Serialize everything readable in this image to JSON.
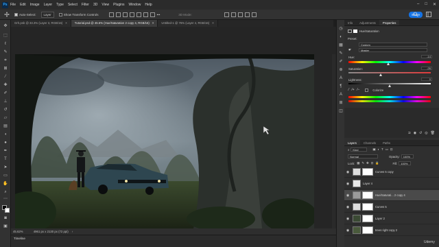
{
  "menubar": {
    "logo": "Ps",
    "items": [
      "File",
      "Edit",
      "Image",
      "Layer",
      "Type",
      "Select",
      "Filter",
      "3D",
      "View",
      "Plugins",
      "Window",
      "Help"
    ],
    "window_controls": [
      "–",
      "□",
      "✕"
    ]
  },
  "options": {
    "auto_select_label": "Auto-Select:",
    "auto_select_value": "Layer",
    "show_transform": "Show Transform Controls",
    "mode_3d": "3D Mode:",
    "share_label": "Share"
  },
  "tabs": [
    {
      "label": "Grh.psb @ 33.3% (Layer 3, RGB/16)",
      "active": false
    },
    {
      "label": "Tutorial.psd @ 45.6% (Hue/Saturation 2 copy 4, RGB/16)",
      "active": true
    },
    {
      "label": "Untitled-1 @ 76% (Layer 4, RGB/16)",
      "active": false
    }
  ],
  "tab_close": "×",
  "status": {
    "zoom": "45.62%",
    "doc_info": "4961 px x 2130 px (72 ppi)",
    "chevron": "›"
  },
  "timeline": {
    "label": "Timeline"
  },
  "properties": {
    "tabs": [
      "Info",
      "Adjustments",
      "Properties"
    ],
    "active_tab": "Properties",
    "title": "Hue/Saturation",
    "preset_label": "Preset:",
    "preset_value": "Custom",
    "channel_value": "Master",
    "hue_label": "Hue:",
    "hue_value": "-14",
    "hue_level": 0.48,
    "saturation_label": "Saturation:",
    "saturation_value": "-26",
    "saturation_level": 0.39,
    "lightness_label": "Lightness:",
    "lightness_value": "0",
    "lightness_level": 0.5,
    "colorize_label": "Colorize"
  },
  "layers_panel": {
    "tabs": [
      "Layers",
      "Channels",
      "Paths"
    ],
    "active_tab": "Layers",
    "kind_label": "Kind",
    "blend_mode": "Normal",
    "opacity_label": "Opacity:",
    "opacity_value": "100%",
    "lock_label": "Lock:",
    "fill_label": "Fill:",
    "fill_value": "100%",
    "layers": [
      {
        "name": "Curves 5 copy",
        "thumb": "adjust",
        "mask": true,
        "selected": false
      },
      {
        "name": "Layer 4",
        "thumb": "light",
        "mask": false,
        "selected": false
      },
      {
        "name": "Hue/Saturati... 2 copy 4",
        "thumb": "adjust",
        "mask": true,
        "selected": true
      },
      {
        "name": "Curves 5",
        "thumb": "adjust",
        "mask": true,
        "selected": false
      },
      {
        "name": "Layer 2",
        "thumb": "photo",
        "mask": true,
        "selected": false
      },
      {
        "name": "trees right copy 2",
        "thumb": "photo",
        "mask": true,
        "selected": false
      }
    ]
  },
  "watermark": "Udemy",
  "colors": {
    "accent": "#1473e6",
    "panel_bg": "#2f2f2f",
    "toolbar_bg": "#323232"
  }
}
